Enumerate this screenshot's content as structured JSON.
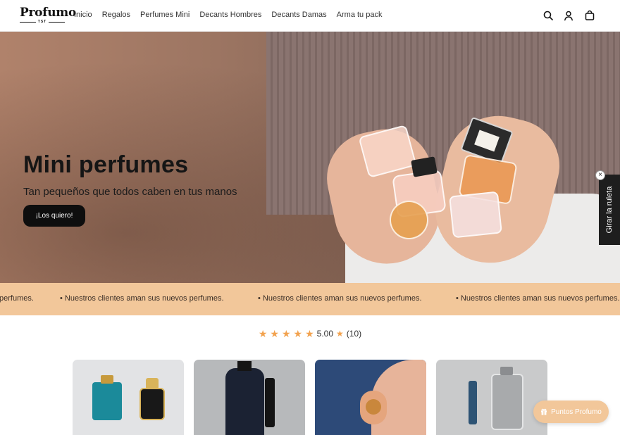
{
  "brand": {
    "name": "Profumo",
    "sub": "TST"
  },
  "nav": {
    "items": [
      "Inicio",
      "Regalos",
      "Perfumes Mini",
      "Decants Hombres",
      "Decants Damas",
      "Arma tu pack"
    ]
  },
  "header_icons": [
    "search-icon",
    "user-icon",
    "cart-icon"
  ],
  "hero": {
    "title": "Mini perfumes",
    "subtitle": "Tan pequeños que todos caben en tus manos",
    "cta": "¡Los quiero!"
  },
  "side_tab": {
    "label": "Girar la ruleta",
    "close": "×"
  },
  "marquee": {
    "items": [
      "perfumes.",
      "•   Nuestros clientes aman sus nuevos perfumes.",
      "•   Nuestros clientes aman sus nuevos perfumes.",
      "•   Nuestros clientes aman sus nuevos perfumes."
    ]
  },
  "rating": {
    "stars": 5,
    "score": "5.00",
    "count": "(10)"
  },
  "points_button": {
    "label": "Puntos Profumo"
  },
  "colors": {
    "accent": "#f2c79a",
    "dark": "#0e0e0e",
    "star": "#f2a24e"
  }
}
